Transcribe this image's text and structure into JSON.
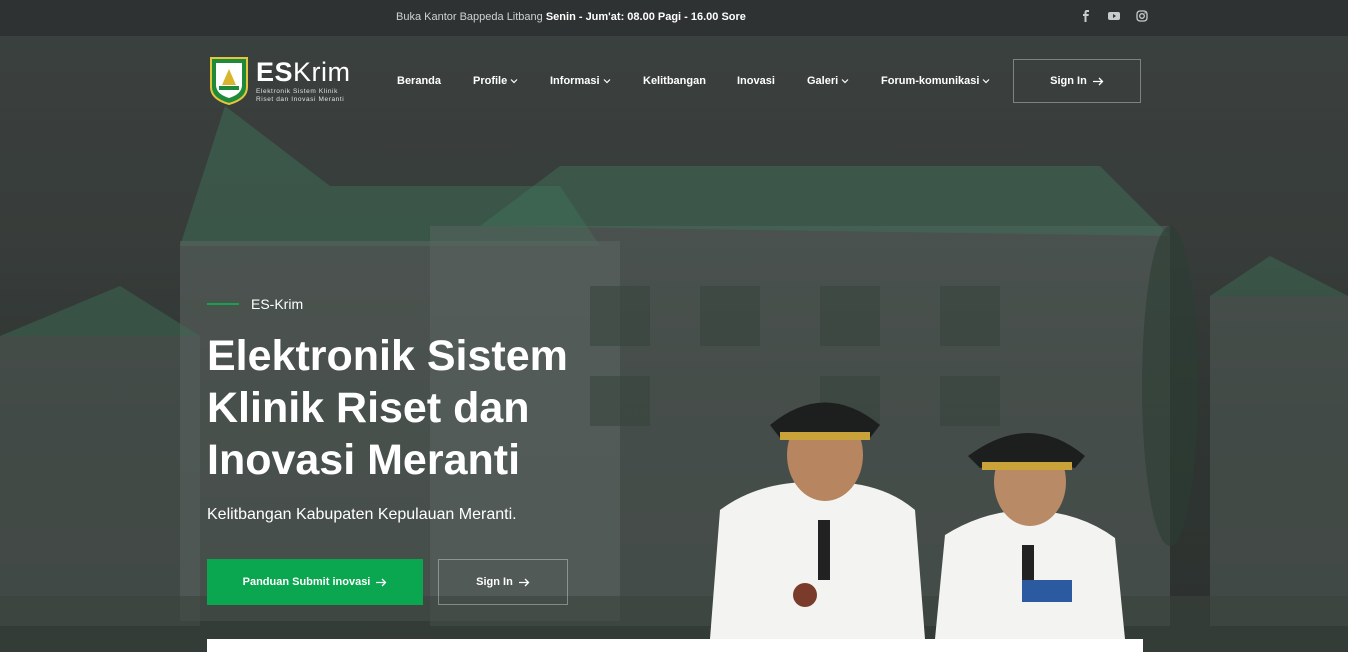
{
  "topbar": {
    "hours_prefix": "Buka Kantor Bappeda Litbang ",
    "hours_bold": "Senin - Jum'at: 08.00 Pagi - 16.00 Sore",
    "social_icons": [
      "facebook-icon",
      "youtube-icon",
      "instagram-icon"
    ]
  },
  "brand": {
    "name_bold": "ES",
    "name_rest": "Krim",
    "tagline_line1": "Elektronik Sistem Klinik",
    "tagline_line2": "Riset dan Inovasi Meranti"
  },
  "nav": {
    "items": [
      {
        "label": "Beranda",
        "dropdown": false
      },
      {
        "label": "Profile",
        "dropdown": true
      },
      {
        "label": "Informasi",
        "dropdown": true
      },
      {
        "label": "Kelitbangan",
        "dropdown": false
      },
      {
        "label": "Inovasi",
        "dropdown": false
      },
      {
        "label": "Galeri",
        "dropdown": true
      },
      {
        "label": "Forum-komunikasi",
        "dropdown": true
      }
    ],
    "signin_label": "Sign In"
  },
  "hero": {
    "eyebrow": "ES-Krim",
    "title_line1": "Elektronik Sistem",
    "title_line2": "Klinik Riset dan",
    "title_line3": "Inovasi Meranti",
    "subtitle": "Kelitbangan Kabupaten Kepulauan Meranti.",
    "primary_button": "Panduan Submit inovasi",
    "secondary_button": "Sign In"
  },
  "colors": {
    "accent_green": "#0aa650",
    "topbar_bg": "#2f3232"
  }
}
